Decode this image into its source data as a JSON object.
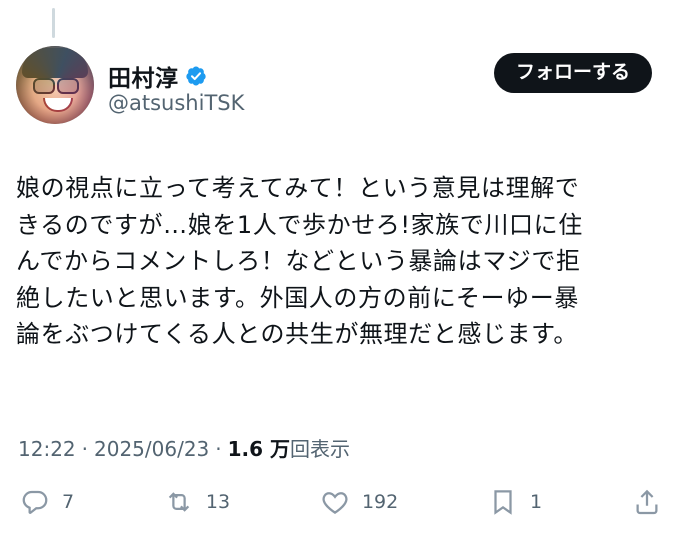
{
  "user": {
    "display_name": "田村淳",
    "handle": "@atsushiTSK",
    "verified": true
  },
  "follow_button_label": "フォローする",
  "tweet": {
    "text": "娘の視点に立って考えてみて！という意見は理解で\nきるのですが…娘を1人で歩かせろ!家族で川口に住\nんでからコメントしろ！などという暴論はマジで拒\n絶したいと思います。外国人の方の前にそーゆー暴\n論をぶつけてくる人との共生が無理だと感じます。",
    "time": "12:22",
    "date": "2025/06/23",
    "views_count": "1.6 万",
    "views_label": "回表示"
  },
  "actions": {
    "replies": "7",
    "reposts": "13",
    "likes": "192",
    "bookmarks": "1"
  },
  "colors": {
    "verified": "#1d9bf0",
    "button_bg": "#0f1419",
    "secondary_text": "#536471"
  },
  "icons": [
    "reply-icon",
    "repost-icon",
    "like-icon",
    "bookmark-icon",
    "share-icon",
    "verified-badge-icon"
  ]
}
